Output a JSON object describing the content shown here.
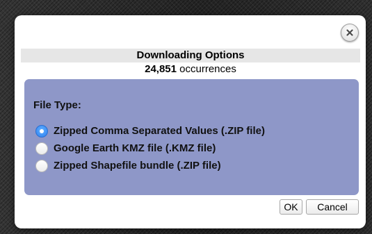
{
  "dialog": {
    "title": "Downloading Options",
    "count_value": "24,851",
    "count_suffix": " occurrences",
    "close_icon": "close-icon"
  },
  "file_type": {
    "label": "File Type:",
    "options": [
      {
        "label": "Zipped Comma Separated Values (.ZIP file)",
        "selected": true
      },
      {
        "label": "Google Earth KMZ file (.KMZ file)",
        "selected": false
      },
      {
        "label": "Zipped Shapefile bundle (.ZIP file)",
        "selected": false
      }
    ]
  },
  "buttons": {
    "ok_label": "OK",
    "cancel_label": "Cancel"
  },
  "colors": {
    "panel_background": "#8e97c8",
    "title_bar_background": "#e6e6e6",
    "radio_selected": "#3a8ef6"
  }
}
